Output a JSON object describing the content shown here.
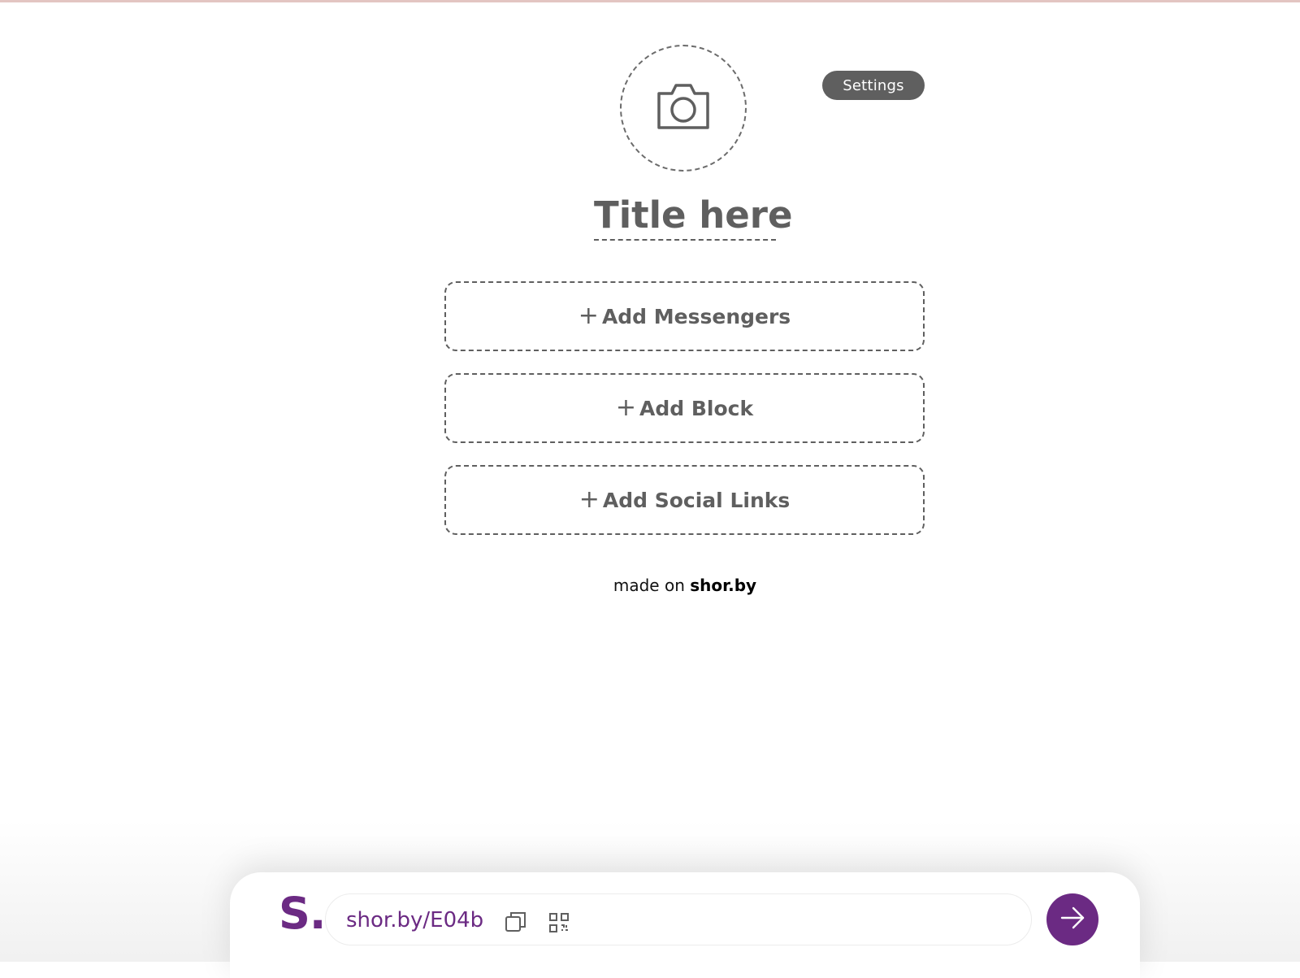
{
  "editor": {
    "settings_label": "Settings",
    "title_placeholder": "Title here",
    "add_messengers_label": "Add Messengers",
    "add_block_label": "Add Block",
    "add_social_links_label": "Add Social Links",
    "plus_glyph": "+"
  },
  "footer": {
    "made_on_prefix": "made on",
    "made_on_brand": "shor.by"
  },
  "bottom_bar": {
    "logo_text": "S.",
    "short_url": "shor.by/E04b"
  },
  "colors": {
    "accent": "#6b2a83",
    "neutral": "#5f5f5f"
  },
  "icons": {
    "avatar": "camera-icon",
    "copy": "copy-icon",
    "qr": "qr-code-icon",
    "go": "arrow-right-icon"
  }
}
